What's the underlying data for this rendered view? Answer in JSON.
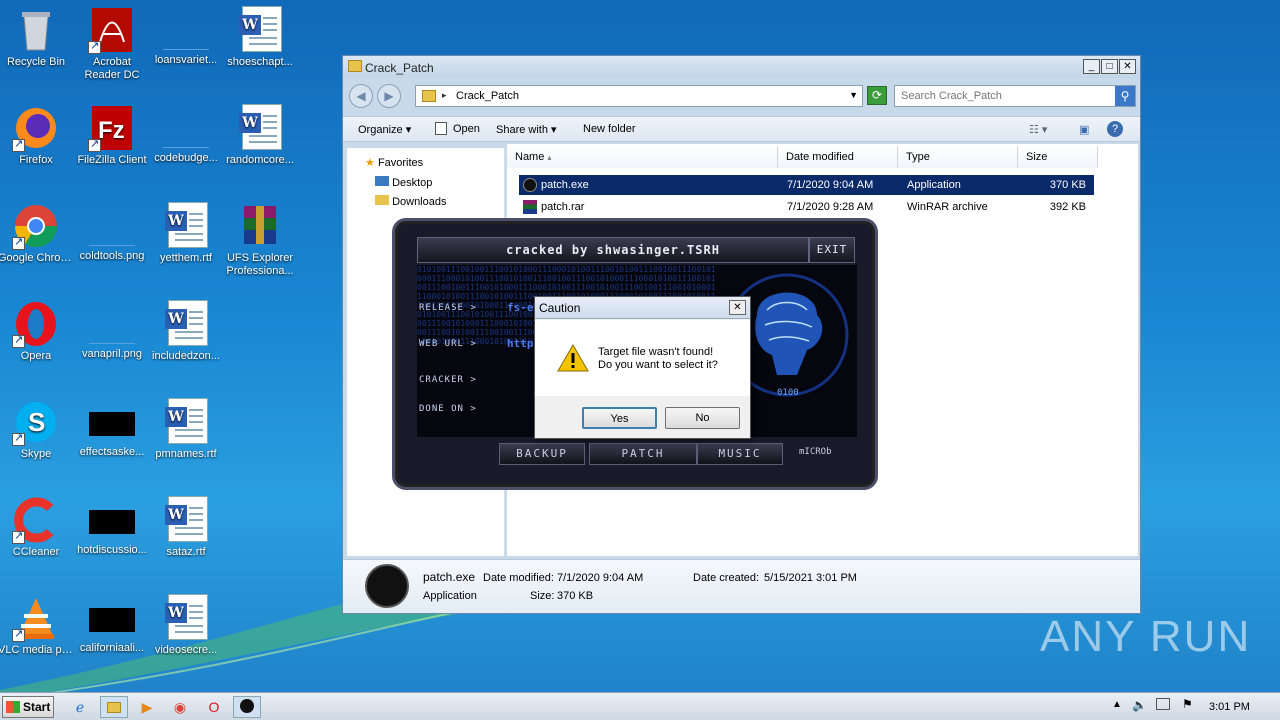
{
  "desktop": {
    "icons": [
      {
        "label": "Recycle Bin",
        "icon": "recycle-bin-icon"
      },
      {
        "label": "Firefox",
        "icon": "firefox-icon"
      },
      {
        "label": "Google Chrome",
        "icon": "chrome-icon"
      },
      {
        "label": "Opera",
        "icon": "opera-icon"
      },
      {
        "label": "Skype",
        "icon": "skype-icon"
      },
      {
        "label": "CCleaner",
        "icon": "ccleaner-icon"
      },
      {
        "label": "VLC media player",
        "icon": "vlc-icon"
      },
      {
        "label": "Acrobat Reader DC",
        "icon": "acrobat-icon"
      },
      {
        "label": "FileZilla Client",
        "icon": "filezilla-icon"
      },
      {
        "label": "coldtools.png",
        "icon": "image-file-icon"
      },
      {
        "label": "vanapril.png",
        "icon": "image-file-icon"
      },
      {
        "label": "effectsaske...",
        "icon": "image-file-icon"
      },
      {
        "label": "hotdiscussio...",
        "icon": "image-file-icon"
      },
      {
        "label": "californiaali...",
        "icon": "image-file-icon"
      },
      {
        "label": "loansvariet...",
        "icon": "image-file-icon"
      },
      {
        "label": "codebudge...",
        "icon": "image-file-icon"
      },
      {
        "label": "yetthem.rtf",
        "icon": "word-doc-icon"
      },
      {
        "label": "includedzon...",
        "icon": "word-doc-icon"
      },
      {
        "label": "pmnames.rtf",
        "icon": "word-doc-icon"
      },
      {
        "label": "sataz.rtf",
        "icon": "word-doc-icon"
      },
      {
        "label": "videosecre...",
        "icon": "word-doc-icon"
      },
      {
        "label": "shoeschapt...",
        "icon": "word-doc-icon"
      },
      {
        "label": "randomcore...",
        "icon": "word-doc-icon"
      },
      {
        "label": "UFS Explorer Professiona...",
        "icon": "winrar-icon"
      }
    ]
  },
  "explorer": {
    "title": "Crack_Patch",
    "address": "Crack_Patch",
    "search_placeholder": "Search Crack_Patch",
    "toolbar": {
      "organize": "Organize",
      "open": "Open",
      "share_with": "Share with",
      "new_folder": "New folder"
    },
    "nav": {
      "favorites": "Favorites",
      "desktop": "Desktop",
      "downloads": "Downloads"
    },
    "columns": {
      "name": "Name",
      "date_modified": "Date modified",
      "type": "Type",
      "size": "Size"
    },
    "files": [
      {
        "name": "patch.exe",
        "date": "7/1/2020 9:04 AM",
        "type": "Application",
        "size": "370 KB"
      },
      {
        "name": "patch.rar",
        "date": "7/1/2020 9:28 AM",
        "type": "WinRAR archive",
        "size": "392 KB"
      }
    ],
    "details": {
      "filename": "patch.exe",
      "date_modified_label": "Date modified:",
      "date_modified": "7/1/2020 9:04 AM",
      "date_created_label": "Date created:",
      "date_created": "5/15/2021 3:01 PM",
      "type": "Application",
      "size_label": "Size:",
      "size": "370 KB"
    }
  },
  "patcher": {
    "title": "cracked by shwasinger.TSRH",
    "exit": "EXIT",
    "release_label": "RELEASE >",
    "release_value": "fs-exp",
    "weburl_label": "WEB URL >",
    "weburl_value": "http",
    "cracker_label": "CRACKER >",
    "doneon_label": "DONE ON >",
    "backup": "BACKUP",
    "patch": "PATCH",
    "music": "MUSIC",
    "micro": "mICROb"
  },
  "dialog": {
    "title": "Caution",
    "line1": "Target file wasn't found!",
    "line2": "Do you want to select it?",
    "yes": "Yes",
    "no": "No"
  },
  "watermark": "ANY RUN",
  "taskbar": {
    "start": "Start",
    "clock": "3:01 PM"
  }
}
